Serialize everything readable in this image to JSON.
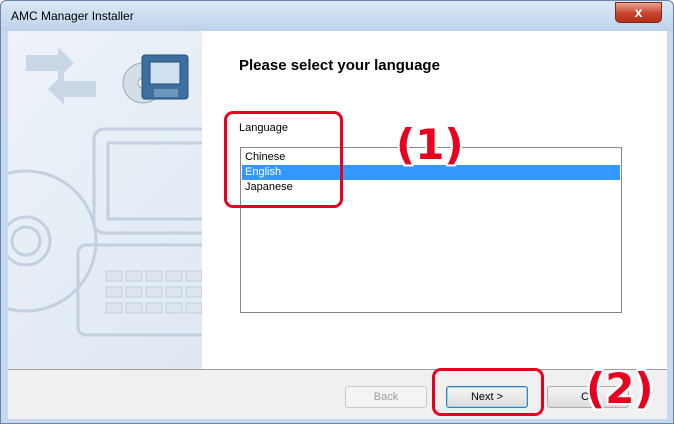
{
  "window": {
    "title": "AMC Manager Installer",
    "close_glyph": "x"
  },
  "content": {
    "heading": "Please select your language",
    "language_label": "Language",
    "languages": [
      "Chinese",
      "English",
      "Japanese"
    ],
    "selected_language": "English"
  },
  "buttons": {
    "back": "Back",
    "next": "Next >",
    "cancel": "Ca"
  },
  "annotations": {
    "one": "(1)",
    "two": "(2)"
  },
  "colors": {
    "selection": "#3399ff",
    "annotation": "#e8001f"
  }
}
